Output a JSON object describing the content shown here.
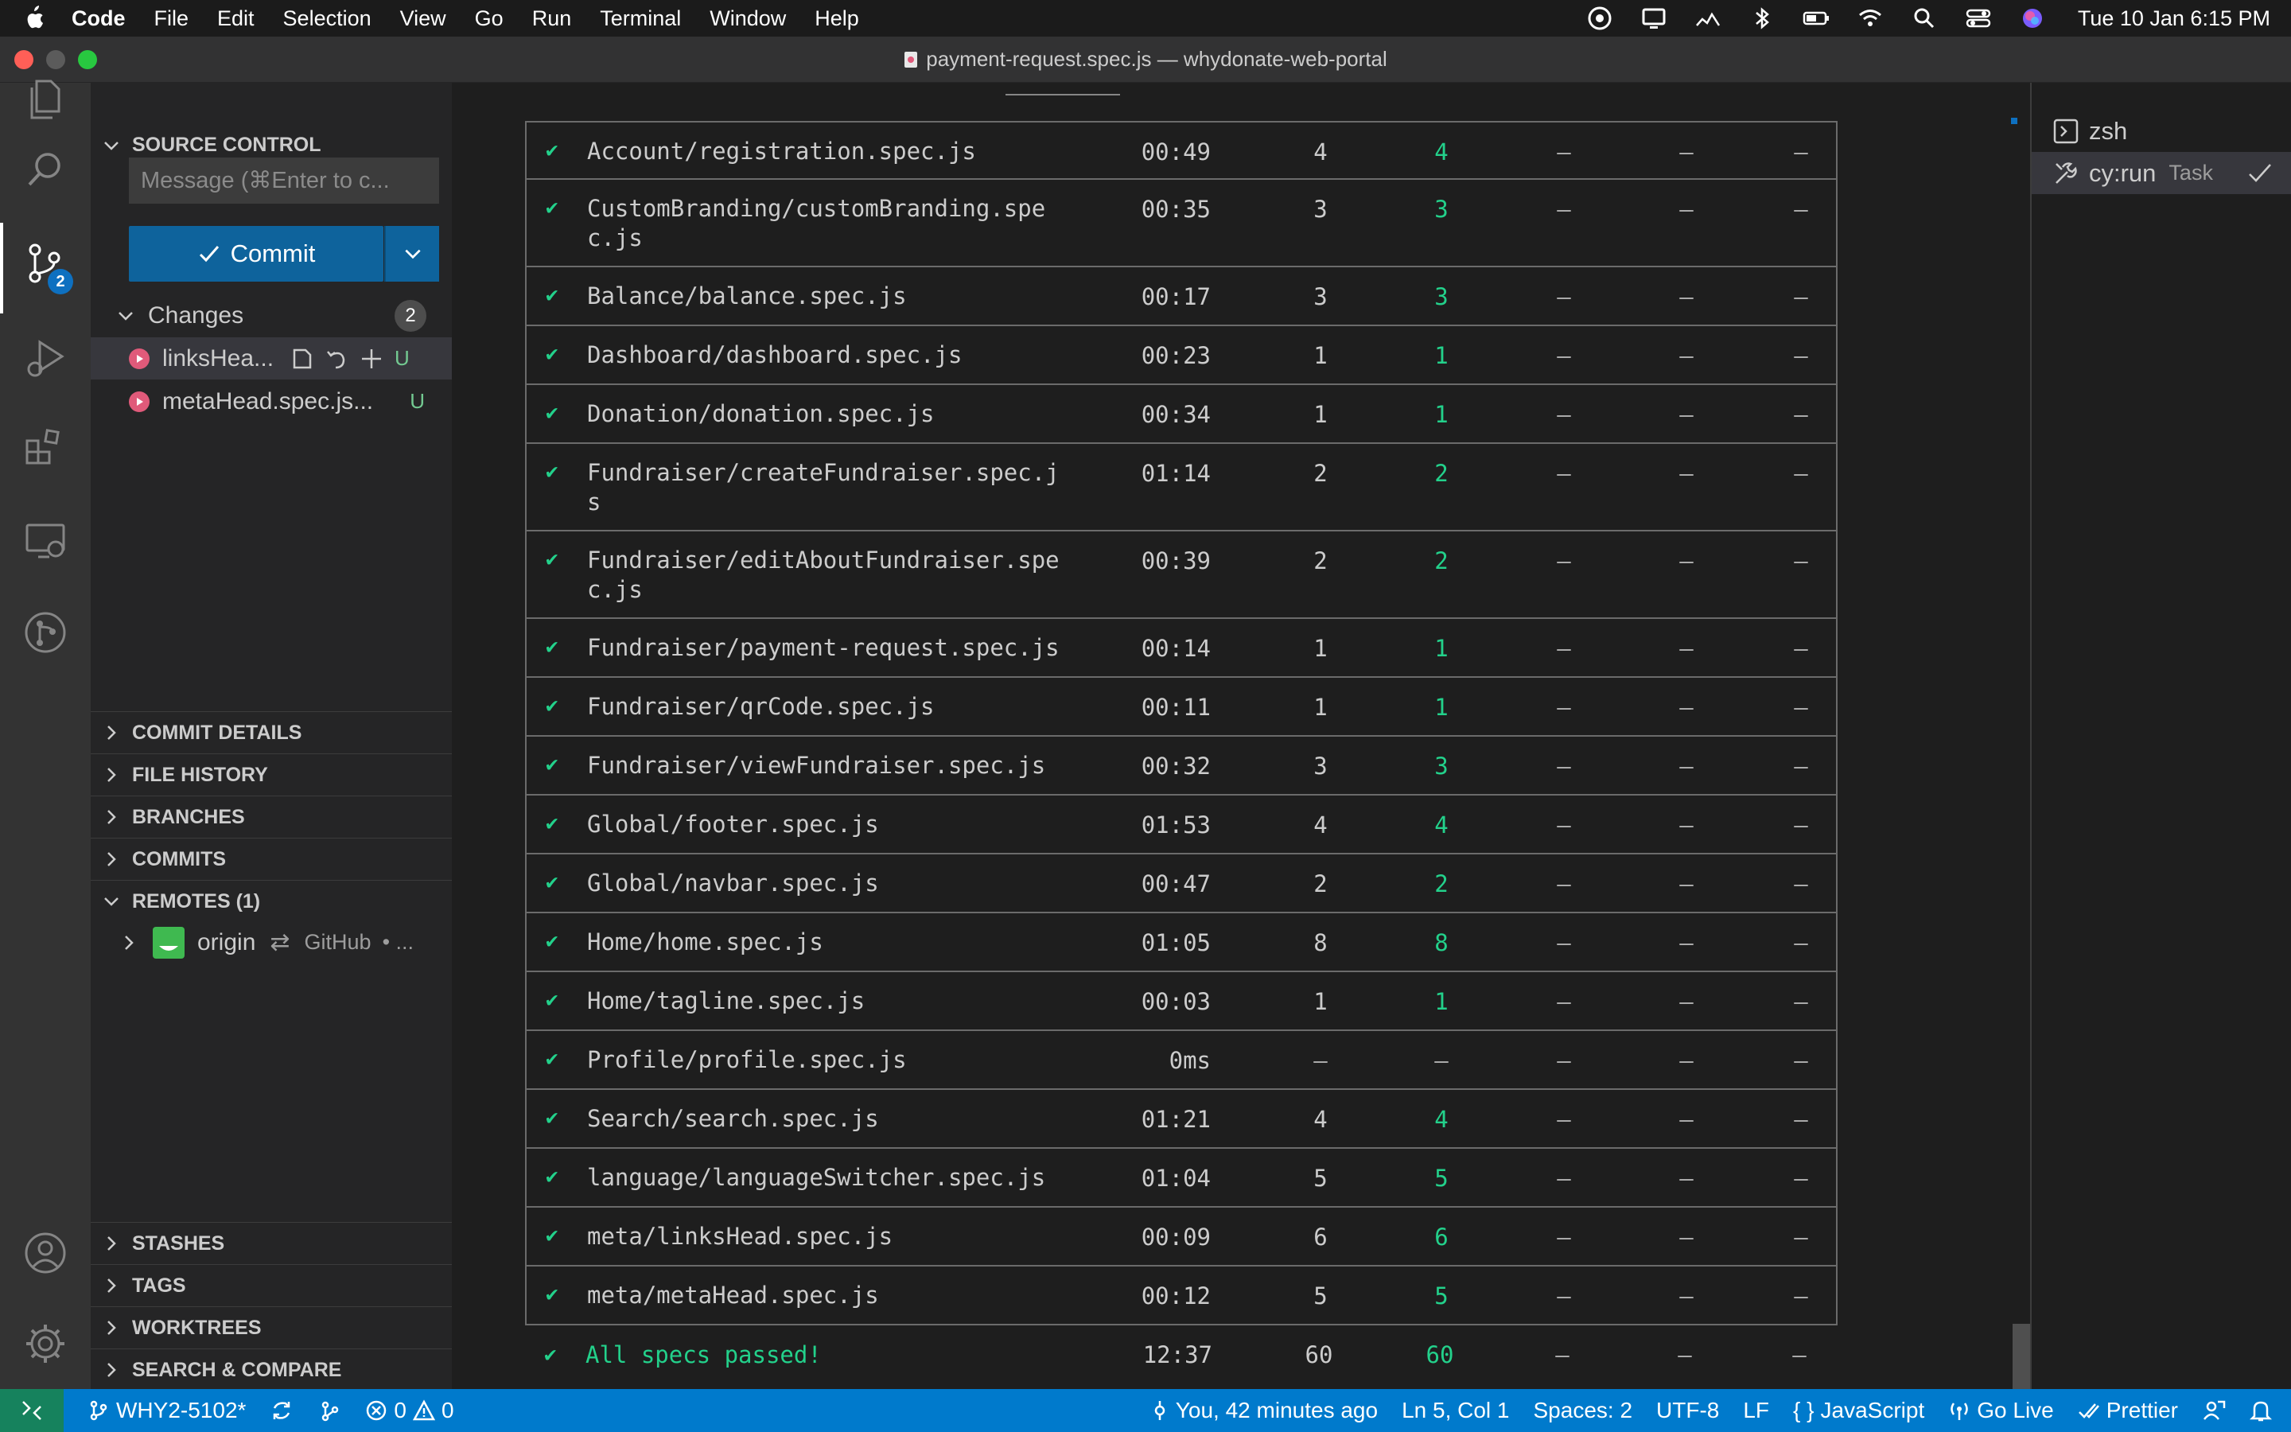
{
  "menubar": {
    "app_name": "Code",
    "items": [
      "File",
      "Edit",
      "Selection",
      "View",
      "Go",
      "Run",
      "Terminal",
      "Window",
      "Help"
    ],
    "clock": "Tue 10 Jan  6:15 PM"
  },
  "window": {
    "title": "payment-request.spec.js — whydonate-web-portal"
  },
  "activity_bar": {
    "scm_badge": "2"
  },
  "sidebar": {
    "header": "SOURCE CONTROL",
    "commit_placeholder": "Message (⌘Enter to c...",
    "commit_label": "Commit",
    "changes_label": "Changes",
    "changes_count": "2",
    "changes": [
      {
        "name": "linksHea...",
        "status": "U"
      },
      {
        "name": "metaHead.spec.js...",
        "status": "U"
      }
    ],
    "sections": {
      "commit_details": "COMMIT DETAILS",
      "file_history": "FILE HISTORY",
      "branches": "BRANCHES",
      "commits": "COMMITS",
      "remotes": "REMOTES (1)",
      "stashes": "STASHES",
      "tags": "TAGS",
      "worktrees": "WORKTREES",
      "search_compare": "SEARCH & COMPARE"
    },
    "remote": {
      "name": "origin",
      "provider": "GitHub",
      "extra": "• ..."
    }
  },
  "results": {
    "rows": [
      {
        "spec": "Account/registration.spec.js",
        "duration": "00:49",
        "tests": "4",
        "passing": "4",
        "failing": "–",
        "pending": "–",
        "skipped": "–"
      },
      {
        "spec": "CustomBranding/customBranding.spec.js",
        "duration": "00:35",
        "tests": "3",
        "passing": "3",
        "failing": "–",
        "pending": "–",
        "skipped": "–"
      },
      {
        "spec": "Balance/balance.spec.js",
        "duration": "00:17",
        "tests": "3",
        "passing": "3",
        "failing": "–",
        "pending": "–",
        "skipped": "–"
      },
      {
        "spec": "Dashboard/dashboard.spec.js",
        "duration": "00:23",
        "tests": "1",
        "passing": "1",
        "failing": "–",
        "pending": "–",
        "skipped": "–"
      },
      {
        "spec": "Donation/donation.spec.js",
        "duration": "00:34",
        "tests": "1",
        "passing": "1",
        "failing": "–",
        "pending": "–",
        "skipped": "–"
      },
      {
        "spec": "Fundraiser/createFundraiser.spec.js",
        "duration": "01:14",
        "tests": "2",
        "passing": "2",
        "failing": "–",
        "pending": "–",
        "skipped": "–"
      },
      {
        "spec": "Fundraiser/editAboutFundraiser.spec.js",
        "duration": "00:39",
        "tests": "2",
        "passing": "2",
        "failing": "–",
        "pending": "–",
        "skipped": "–"
      },
      {
        "spec": "Fundraiser/payment-request.spec.js",
        "duration": "00:14",
        "tests": "1",
        "passing": "1",
        "failing": "–",
        "pending": "–",
        "skipped": "–"
      },
      {
        "spec": "Fundraiser/qrCode.spec.js",
        "duration": "00:11",
        "tests": "1",
        "passing": "1",
        "failing": "–",
        "pending": "–",
        "skipped": "–"
      },
      {
        "spec": "Fundraiser/viewFundraiser.spec.js",
        "duration": "00:32",
        "tests": "3",
        "passing": "3",
        "failing": "–",
        "pending": "–",
        "skipped": "–"
      },
      {
        "spec": "Global/footer.spec.js",
        "duration": "01:53",
        "tests": "4",
        "passing": "4",
        "failing": "–",
        "pending": "–",
        "skipped": "–"
      },
      {
        "spec": "Global/navbar.spec.js",
        "duration": "00:47",
        "tests": "2",
        "passing": "2",
        "failing": "–",
        "pending": "–",
        "skipped": "–"
      },
      {
        "spec": "Home/home.spec.js",
        "duration": "01:05",
        "tests": "8",
        "passing": "8",
        "failing": "–",
        "pending": "–",
        "skipped": "–"
      },
      {
        "spec": "Home/tagline.spec.js",
        "duration": "00:03",
        "tests": "1",
        "passing": "1",
        "failing": "–",
        "pending": "–",
        "skipped": "–"
      },
      {
        "spec": "Profile/profile.spec.js",
        "duration": "0ms",
        "tests": "–",
        "passing": "–",
        "failing": "–",
        "pending": "–",
        "skipped": "–"
      },
      {
        "spec": "Search/search.spec.js",
        "duration": "01:21",
        "tests": "4",
        "passing": "4",
        "failing": "–",
        "pending": "–",
        "skipped": "–"
      },
      {
        "spec": "language/languageSwitcher.spec.js",
        "duration": "01:04",
        "tests": "5",
        "passing": "5",
        "failing": "–",
        "pending": "–",
        "skipped": "–"
      },
      {
        "spec": "meta/linksHead.spec.js",
        "duration": "00:09",
        "tests": "6",
        "passing": "6",
        "failing": "–",
        "pending": "–",
        "skipped": "–"
      },
      {
        "spec": "meta/metaHead.spec.js",
        "duration": "00:12",
        "tests": "5",
        "passing": "5",
        "failing": "–",
        "pending": "–",
        "skipped": "–"
      }
    ],
    "summary": {
      "label": "All specs passed!",
      "duration": "12:37",
      "tests": "60",
      "passing": "60",
      "failing": "–",
      "pending": "–",
      "skipped": "–"
    },
    "check_glyph": "✔"
  },
  "terminal_list": {
    "items": [
      {
        "name": "zsh",
        "task": ""
      },
      {
        "name": "cy:run",
        "task": "Task"
      }
    ]
  },
  "statusbar": {
    "branch": "WHY2-5102*",
    "errors": "0",
    "warnings": "0",
    "blame": "You, 42 minutes ago",
    "position": "Ln 5, Col 1",
    "spaces": "Spaces: 2",
    "encoding": "UTF-8",
    "eol": "LF",
    "language": "JavaScript",
    "go_live": "Go Live",
    "prettier": "Prettier"
  },
  "colors": {
    "accent": "#007acc",
    "pass_green": "#23d18b",
    "commit_button": "#0e639c"
  }
}
